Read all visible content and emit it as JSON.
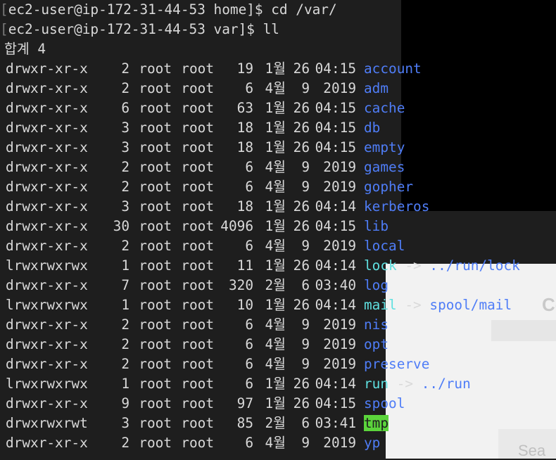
{
  "prompt": {
    "bracket": "[",
    "line1": "[ec2-user@ip-172-31-44-53 home]$ cd /var/",
    "line2": "[ec2-user@ip-172-31-44-53 var]$ ll"
  },
  "total_line": "합계 4",
  "listing": [
    {
      "perm": "drwxr-xr-x",
      "links": "2",
      "owner": "root",
      "group": "root",
      "size": "19",
      "month": "1월",
      "day": "26",
      "time": "04:15",
      "name": "account",
      "kind": "dir"
    },
    {
      "perm": "drwxr-xr-x",
      "links": "2",
      "owner": "root",
      "group": "root",
      "size": "6",
      "month": "4월",
      "day": "9",
      "time": "2019",
      "name": "adm",
      "kind": "dir"
    },
    {
      "perm": "drwxr-xr-x",
      "links": "6",
      "owner": "root",
      "group": "root",
      "size": "63",
      "month": "1월",
      "day": "26",
      "time": "04:15",
      "name": "cache",
      "kind": "dir"
    },
    {
      "perm": "drwxr-xr-x",
      "links": "3",
      "owner": "root",
      "group": "root",
      "size": "18",
      "month": "1월",
      "day": "26",
      "time": "04:15",
      "name": "db",
      "kind": "dir"
    },
    {
      "perm": "drwxr-xr-x",
      "links": "3",
      "owner": "root",
      "group": "root",
      "size": "18",
      "month": "1월",
      "day": "26",
      "time": "04:15",
      "name": "empty",
      "kind": "dir"
    },
    {
      "perm": "drwxr-xr-x",
      "links": "2",
      "owner": "root",
      "group": "root",
      "size": "6",
      "month": "4월",
      "day": "9",
      "time": "2019",
      "name": "games",
      "kind": "dir"
    },
    {
      "perm": "drwxr-xr-x",
      "links": "2",
      "owner": "root",
      "group": "root",
      "size": "6",
      "month": "4월",
      "day": "9",
      "time": "2019",
      "name": "gopher",
      "kind": "dir"
    },
    {
      "perm": "drwxr-xr-x",
      "links": "3",
      "owner": "root",
      "group": "root",
      "size": "18",
      "month": "1월",
      "day": "26",
      "time": "04:14",
      "name": "kerberos",
      "kind": "dir"
    },
    {
      "perm": "drwxr-xr-x",
      "links": "30",
      "owner": "root",
      "group": "root",
      "size": "4096",
      "month": "1월",
      "day": "26",
      "time": "04:15",
      "name": "lib",
      "kind": "dir"
    },
    {
      "perm": "drwxr-xr-x",
      "links": "2",
      "owner": "root",
      "group": "root",
      "size": "6",
      "month": "4월",
      "day": "9",
      "time": "2019",
      "name": "local",
      "kind": "dir"
    },
    {
      "perm": "lrwxrwxrwx",
      "links": "1",
      "owner": "root",
      "group": "root",
      "size": "11",
      "month": "1월",
      "day": "26",
      "time": "04:14",
      "name": "lock",
      "kind": "link",
      "target": "../run/lock"
    },
    {
      "perm": "drwxr-xr-x",
      "links": "7",
      "owner": "root",
      "group": "root",
      "size": "320",
      "month": "2월",
      "day": "6",
      "time": "03:40",
      "name": "log",
      "kind": "dir"
    },
    {
      "perm": "lrwxrwxrwx",
      "links": "1",
      "owner": "root",
      "group": "root",
      "size": "10",
      "month": "1월",
      "day": "26",
      "time": "04:14",
      "name": "mail",
      "kind": "link",
      "target": "spool/mail"
    },
    {
      "perm": "drwxr-xr-x",
      "links": "2",
      "owner": "root",
      "group": "root",
      "size": "6",
      "month": "4월",
      "day": "9",
      "time": "2019",
      "name": "nis",
      "kind": "dir"
    },
    {
      "perm": "drwxr-xr-x",
      "links": "2",
      "owner": "root",
      "group": "root",
      "size": "6",
      "month": "4월",
      "day": "9",
      "time": "2019",
      "name": "opt",
      "kind": "dir"
    },
    {
      "perm": "drwxr-xr-x",
      "links": "2",
      "owner": "root",
      "group": "root",
      "size": "6",
      "month": "4월",
      "day": "9",
      "time": "2019",
      "name": "preserve",
      "kind": "dir"
    },
    {
      "perm": "lrwxrwxrwx",
      "links": "1",
      "owner": "root",
      "group": "root",
      "size": "6",
      "month": "1월",
      "day": "26",
      "time": "04:14",
      "name": "run",
      "kind": "link",
      "target": "../run"
    },
    {
      "perm": "drwxr-xr-x",
      "links": "9",
      "owner": "root",
      "group": "root",
      "size": "97",
      "month": "1월",
      "day": "26",
      "time": "04:15",
      "name": "spool",
      "kind": "dir"
    },
    {
      "perm": "drwxrwxrwt",
      "links": "3",
      "owner": "root",
      "group": "root",
      "size": "85",
      "month": "2월",
      "day": "6",
      "time": "03:41",
      "name": "tmp",
      "kind": "sticky"
    },
    {
      "perm": "drwxr-xr-x",
      "links": "2",
      "owner": "root",
      "group": "root",
      "size": "6",
      "month": "4월",
      "day": "9",
      "time": "2019",
      "name": "yp",
      "kind": "dir"
    }
  ],
  "symlink_arrow": "->",
  "background": {
    "partial_text_1": "Co",
    "partial_text_2": "Sea"
  },
  "colors": {
    "terminal_bg": "#1e1e1e",
    "text": "#d9d9d9",
    "directory": "#4f7df7",
    "symlink": "#5fe0e0",
    "sticky_bg": "#5bd43b"
  }
}
